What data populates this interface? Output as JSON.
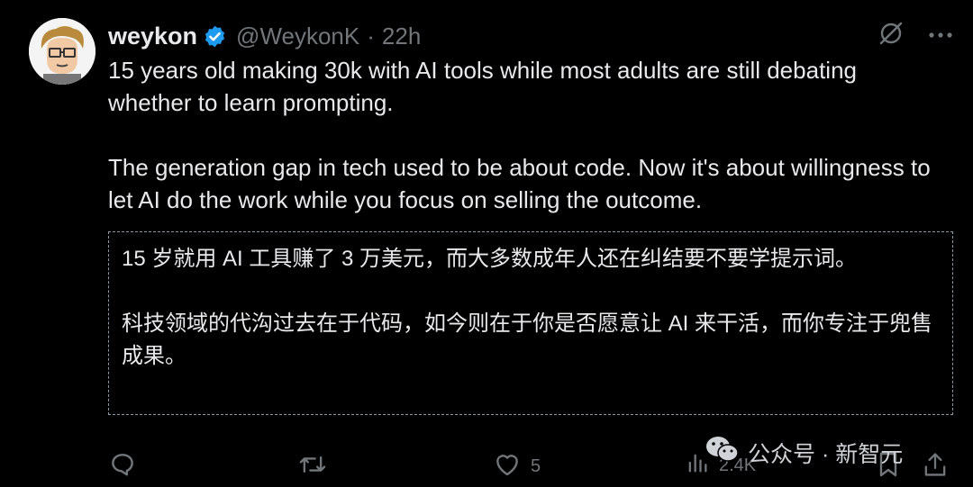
{
  "author": {
    "display_name": "weykon",
    "handle": "@WeykonK",
    "separator": "·",
    "time": "22h"
  },
  "tweet": {
    "paragraphs": [
      "15 years old making 30k with AI tools while most adults are still debating whether to learn prompting.",
      "The generation gap in tech used to be about code. Now it's about willingness to let AI do the work while you focus on selling the outcome."
    ]
  },
  "translation": {
    "paragraphs": [
      "15 岁就用 AI 工具赚了 3 万美元，而大多数成年人还在纠结要不要学提示词。",
      "科技领域的代沟过去在于代码，如今则在于你是否愿意让 AI 来干活，而你专注于兜售成果。"
    ]
  },
  "actions": {
    "reply_count": "",
    "retweet_count": "",
    "like_count": "5",
    "view_count": "2.4K"
  },
  "watermark": {
    "text": "公众号 · 新智元"
  },
  "icons": [
    "verified-badge-icon",
    "grok-icon",
    "more-icon",
    "reply-icon",
    "retweet-icon",
    "like-icon",
    "views-icon",
    "bookmark-icon",
    "share-icon",
    "wechat-icon"
  ],
  "colors": {
    "background": "#000000",
    "text": "#e7e9ea",
    "muted": "#71767b",
    "verified": "#1d9bf0"
  }
}
